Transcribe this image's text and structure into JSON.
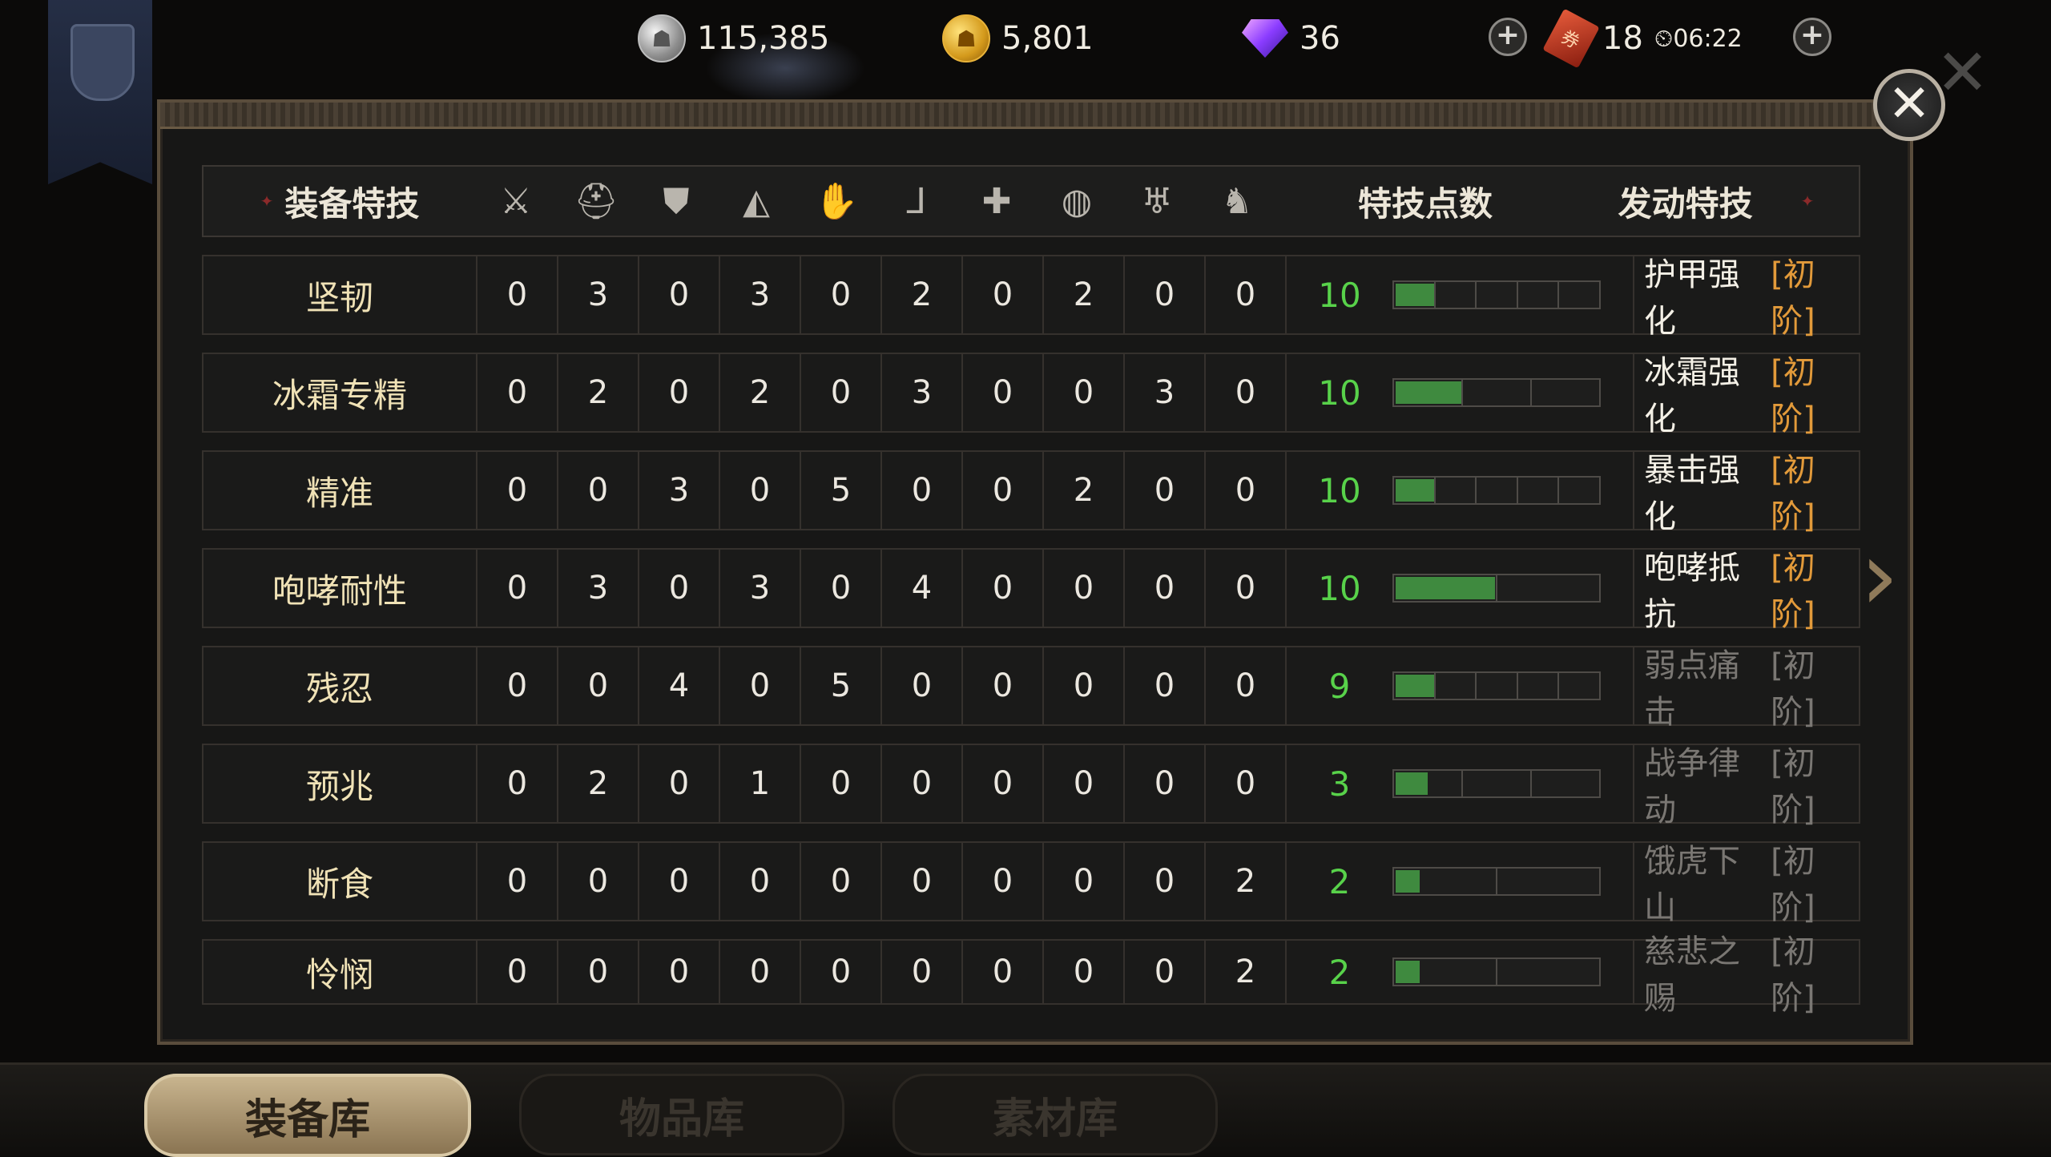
{
  "resources": {
    "silver": "115,385",
    "gold": "5,801",
    "gems": "36",
    "tickets": "18",
    "timer": "06:22"
  },
  "table": {
    "header": {
      "name_col": "装备特技",
      "points_col": "特技点数",
      "skill_col": "发动特技",
      "slot_icons": [
        "sword-icon",
        "helmet-icon",
        "chest-armor-icon",
        "shoulder-icon",
        "gauntlet-icon",
        "boots-icon",
        "weapon-offhand-icon",
        "ring-icon",
        "amulet-icon",
        "mount-icon"
      ]
    },
    "rows": [
      {
        "name": "坚韧",
        "values": [
          "0",
          "3",
          "0",
          "3",
          "0",
          "2",
          "0",
          "2",
          "0",
          "0"
        ],
        "points": "10",
        "segments": 5,
        "filled": 1,
        "skill": "护甲强化",
        "tier": "[初阶]",
        "active": true
      },
      {
        "name": "冰霜专精",
        "values": [
          "0",
          "2",
          "0",
          "2",
          "0",
          "3",
          "0",
          "0",
          "3",
          "0"
        ],
        "points": "10",
        "segments": 3,
        "filled": 1,
        "skill": "冰霜强化",
        "tier": "[初阶]",
        "active": true
      },
      {
        "name": "精准",
        "values": [
          "0",
          "0",
          "3",
          "0",
          "5",
          "0",
          "0",
          "2",
          "0",
          "0"
        ],
        "points": "10",
        "segments": 5,
        "filled": 1,
        "skill": "暴击强化",
        "tier": "[初阶]",
        "active": true
      },
      {
        "name": "咆哮耐性",
        "values": [
          "0",
          "3",
          "0",
          "3",
          "0",
          "4",
          "0",
          "0",
          "0",
          "0"
        ],
        "points": "10",
        "segments": 2,
        "filled": 1,
        "skill": "咆哮抵抗",
        "tier": "[初阶]",
        "active": true
      },
      {
        "name": "残忍",
        "values": [
          "0",
          "0",
          "4",
          "0",
          "5",
          "0",
          "0",
          "0",
          "0",
          "0"
        ],
        "points": "9",
        "segments": 5,
        "filled": 1,
        "skill": "弱点痛击",
        "tier": "[初阶]",
        "active": false
      },
      {
        "name": "预兆",
        "values": [
          "0",
          "2",
          "0",
          "1",
          "0",
          "0",
          "0",
          "0",
          "0",
          "0"
        ],
        "points": "3",
        "segments": 3,
        "filled": 0.5,
        "skill": "战争律动",
        "tier": "[初阶]",
        "active": false
      },
      {
        "name": "断食",
        "values": [
          "0",
          "0",
          "0",
          "0",
          "0",
          "0",
          "0",
          "0",
          "0",
          "2"
        ],
        "points": "2",
        "segments": 2,
        "filled": 0.25,
        "skill": "饿虎下山",
        "tier": "[初阶]",
        "active": false
      },
      {
        "name": "怜悯",
        "values": [
          "0",
          "0",
          "0",
          "0",
          "0",
          "0",
          "0",
          "0",
          "0",
          "2"
        ],
        "points": "2",
        "segments": 2,
        "filled": 0.25,
        "skill": "慈悲之赐",
        "tier": "[初阶]",
        "active": false
      }
    ]
  },
  "tabs": [
    {
      "label": "装备库",
      "active": true
    },
    {
      "label": "物品库",
      "active": false
    },
    {
      "label": "素材库",
      "active": false
    }
  ],
  "colors": {
    "points_green": "#58d24a",
    "tier_orange": "#e29a3a",
    "bar_fill": "#3f8a3f"
  }
}
